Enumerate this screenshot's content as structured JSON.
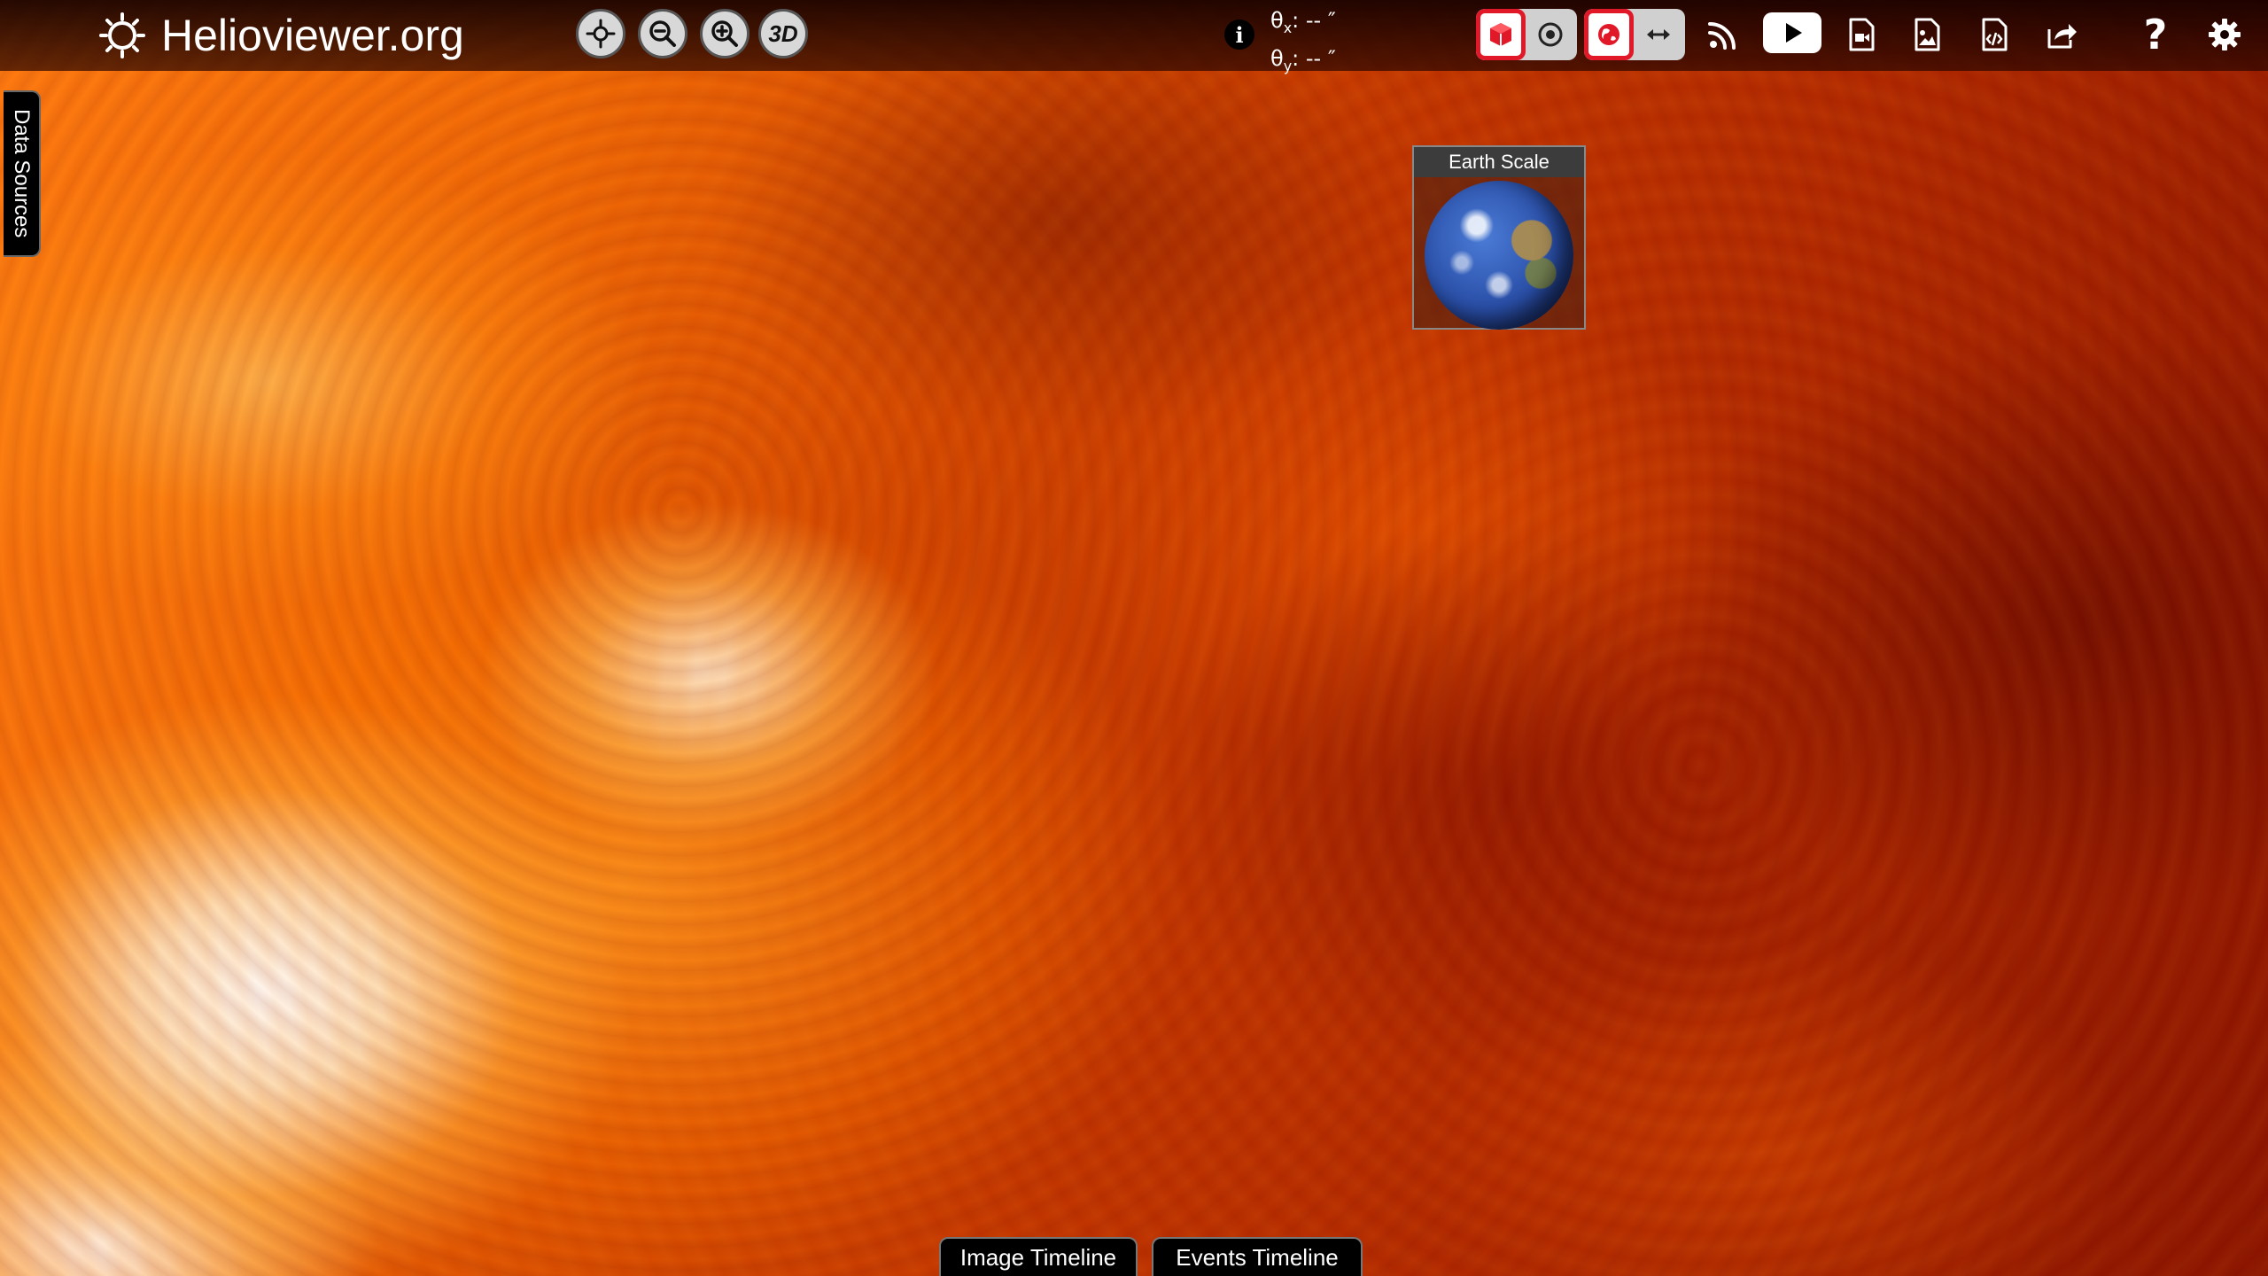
{
  "header": {
    "brand_title": "Helioviewer.org",
    "coords": {
      "x_label": "θ",
      "x_sub": "x",
      "x_value": ": -- ″",
      "y_label": "θ",
      "y_sub": "y",
      "y_value": ": -- ″"
    },
    "buttons": {
      "center_view": "center-icon",
      "zoom_out": "zoom-out-icon",
      "zoom_in": "zoom-in-icon",
      "three_d_label": "3D",
      "info": "i"
    },
    "help_label": "?"
  },
  "sidebar": {
    "data_sources_label": "Data Sources"
  },
  "earth_scale": {
    "title": "Earth Scale"
  },
  "timelines": {
    "image_timeline_label": "Image Timeline",
    "events_timeline_label": "Events Timeline"
  },
  "colors": {
    "accent_red": "#e01828",
    "header_bg": "#140000",
    "button_gray": "#d8d8d8"
  }
}
